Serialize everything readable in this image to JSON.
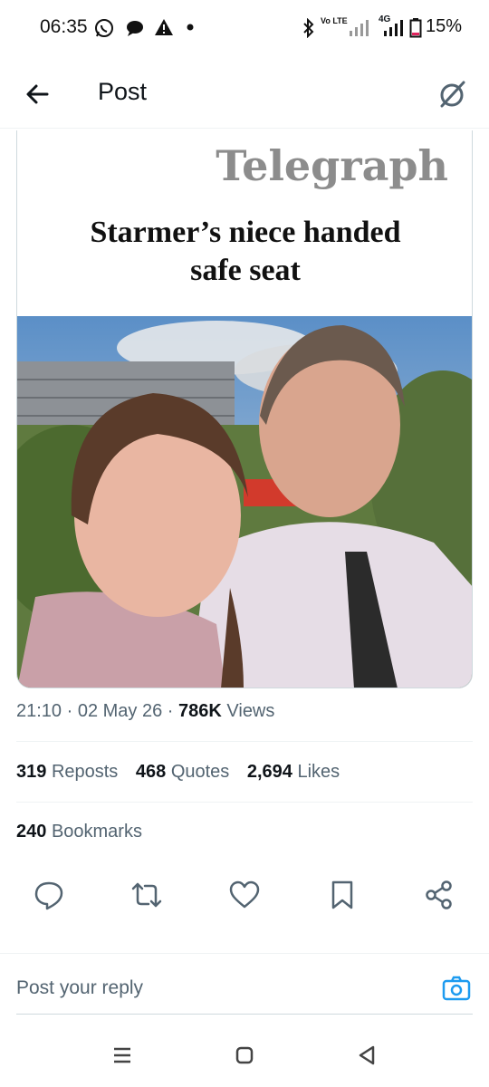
{
  "status_bar": {
    "time": "06:35",
    "battery": "15%",
    "network": "4G",
    "volte": "Vo LTE",
    "icons": [
      "whatsapp-icon",
      "chat-icon",
      "warning-icon",
      "dot-icon",
      "bluetooth-icon",
      "volte-icon",
      "signal-icon",
      "battery-icon"
    ]
  },
  "header": {
    "title": "Post",
    "back_icon": "arrow-left-icon",
    "grok_icon": "grok-icon"
  },
  "post": {
    "image": {
      "masthead": "Telegraph",
      "headline_line1": "Starmer’s niece handed",
      "headline_line2": "safe seat"
    },
    "time": "21:10",
    "date": "02 May 26",
    "views_count": "786K",
    "views_label": "Views",
    "stats": [
      {
        "count": "319",
        "label": "Reposts"
      },
      {
        "count": "468",
        "label": "Quotes"
      },
      {
        "count": "2,694",
        "label": "Likes"
      }
    ],
    "bookmarks": {
      "count": "240",
      "label": "Bookmarks"
    }
  },
  "actions": [
    "reply-icon",
    "repost-icon",
    "like-icon",
    "bookmark-icon",
    "share-icon"
  ],
  "reply_bar": {
    "placeholder": "Post your reply",
    "camera_icon": "camera-icon"
  },
  "nav_bar": [
    "recents-icon",
    "home-icon",
    "back-icon"
  ],
  "colors": {
    "accent": "#1d9bf0",
    "secondary_text": "#536471",
    "primary_text": "#0f1419",
    "border": "#cfd9de"
  }
}
